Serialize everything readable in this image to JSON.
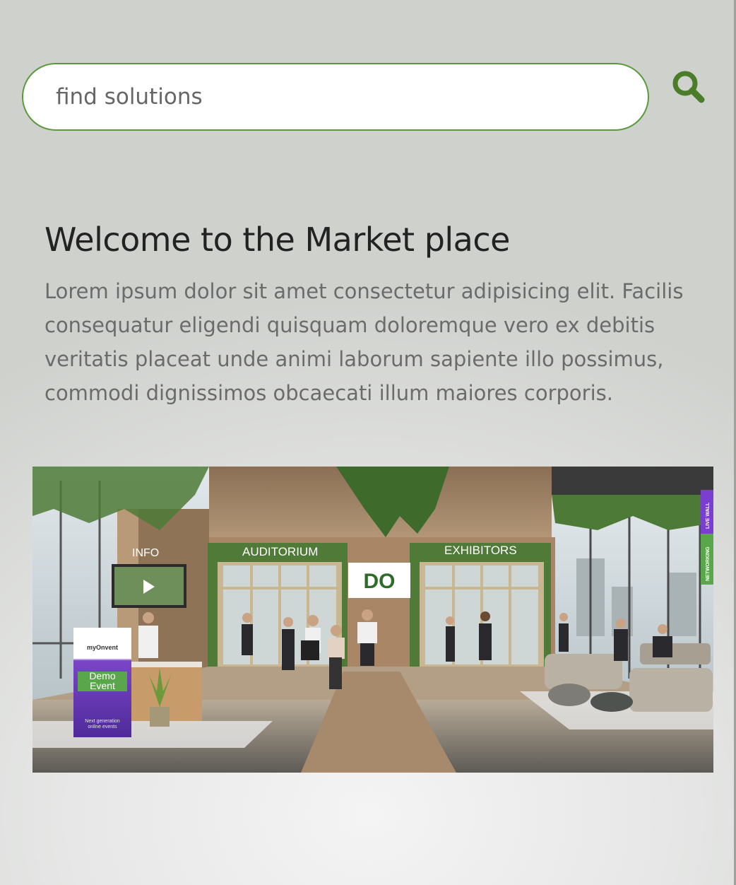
{
  "search": {
    "placeholder": "find solutions",
    "icon": "search-icon",
    "accent_color": "#4a7c2a"
  },
  "main": {
    "title": "Welcome to the Market place",
    "description": "Lorem ipsum dolor sit amet consectetur adipisicing elit. Facilis consequatur eligendi quisquam doloremque vero ex debitis veritatis placeat unde animi laborum sapiente illo possimus, commodi dignissimos obcaecati illum maiores corporis."
  },
  "scene": {
    "info_label": "INFO",
    "auditorium_label": "AUDITORIUM",
    "exhibitors_label": "EXHIBITORS",
    "live_wall_label": "LIVE WALL",
    "networking_label": "NETWORKING",
    "logo_text": "DO",
    "banner": {
      "brand": "myOnvent",
      "title_line1": "Demo",
      "title_line2": "Event",
      "tagline_line1": "Next generation",
      "tagline_line2": "online events"
    }
  }
}
